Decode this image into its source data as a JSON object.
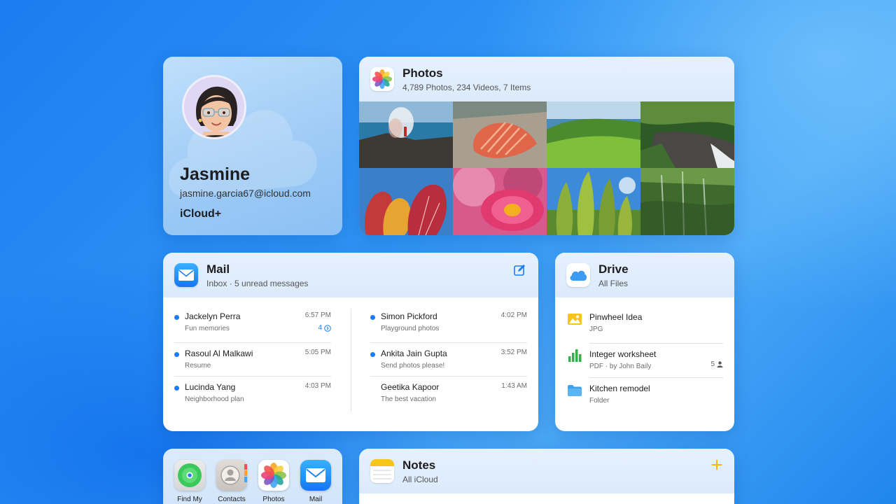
{
  "profile": {
    "name": "Jasmine",
    "email": "jasmine.garcia67@icloud.com",
    "plan": "iCloud+"
  },
  "photos": {
    "title": "Photos",
    "subtitle": "4,789 Photos, 234 Videos, 7 Items"
  },
  "mail": {
    "title": "Mail",
    "subtitle": "Inbox · 5 unread messages",
    "left": [
      {
        "from": "Jackelyn Perra",
        "subject": "Fun memories",
        "time": "6:57 PM",
        "count": "4",
        "unread": true
      },
      {
        "from": "Rasoul Al Malkawi",
        "subject": "Resume",
        "time": "5:05 PM",
        "unread": true
      },
      {
        "from": "Lucinda Yang",
        "subject": "Neighborhood plan",
        "time": "4:03 PM",
        "unread": true
      }
    ],
    "right": [
      {
        "from": "Simon Pickford",
        "subject": "Playground photos",
        "time": "4:02 PM",
        "unread": true
      },
      {
        "from": "Ankita Jain Gupta",
        "subject": "Send photos please!",
        "time": "3:52 PM",
        "unread": true
      },
      {
        "from": "Geetika Kapoor",
        "subject": "The best vacation",
        "time": "1:43 AM",
        "unread": false
      }
    ]
  },
  "drive": {
    "title": "Drive",
    "subtitle": "All Files",
    "items": [
      {
        "name": "Pinwheel Idea",
        "meta": "JPG"
      },
      {
        "name": "Integer worksheet",
        "meta": "PDF · by John Baily",
        "shared": "5"
      },
      {
        "name": "Kitchen remodel",
        "meta": "Folder"
      }
    ]
  },
  "apps": [
    {
      "label": "Find My"
    },
    {
      "label": "Contacts"
    },
    {
      "label": "Photos"
    },
    {
      "label": "Mail"
    }
  ],
  "notes": {
    "title": "Notes",
    "subtitle": "All iCloud"
  },
  "colors": {
    "accent": "#1a7cf0",
    "notes_accent": "#f5b800"
  }
}
